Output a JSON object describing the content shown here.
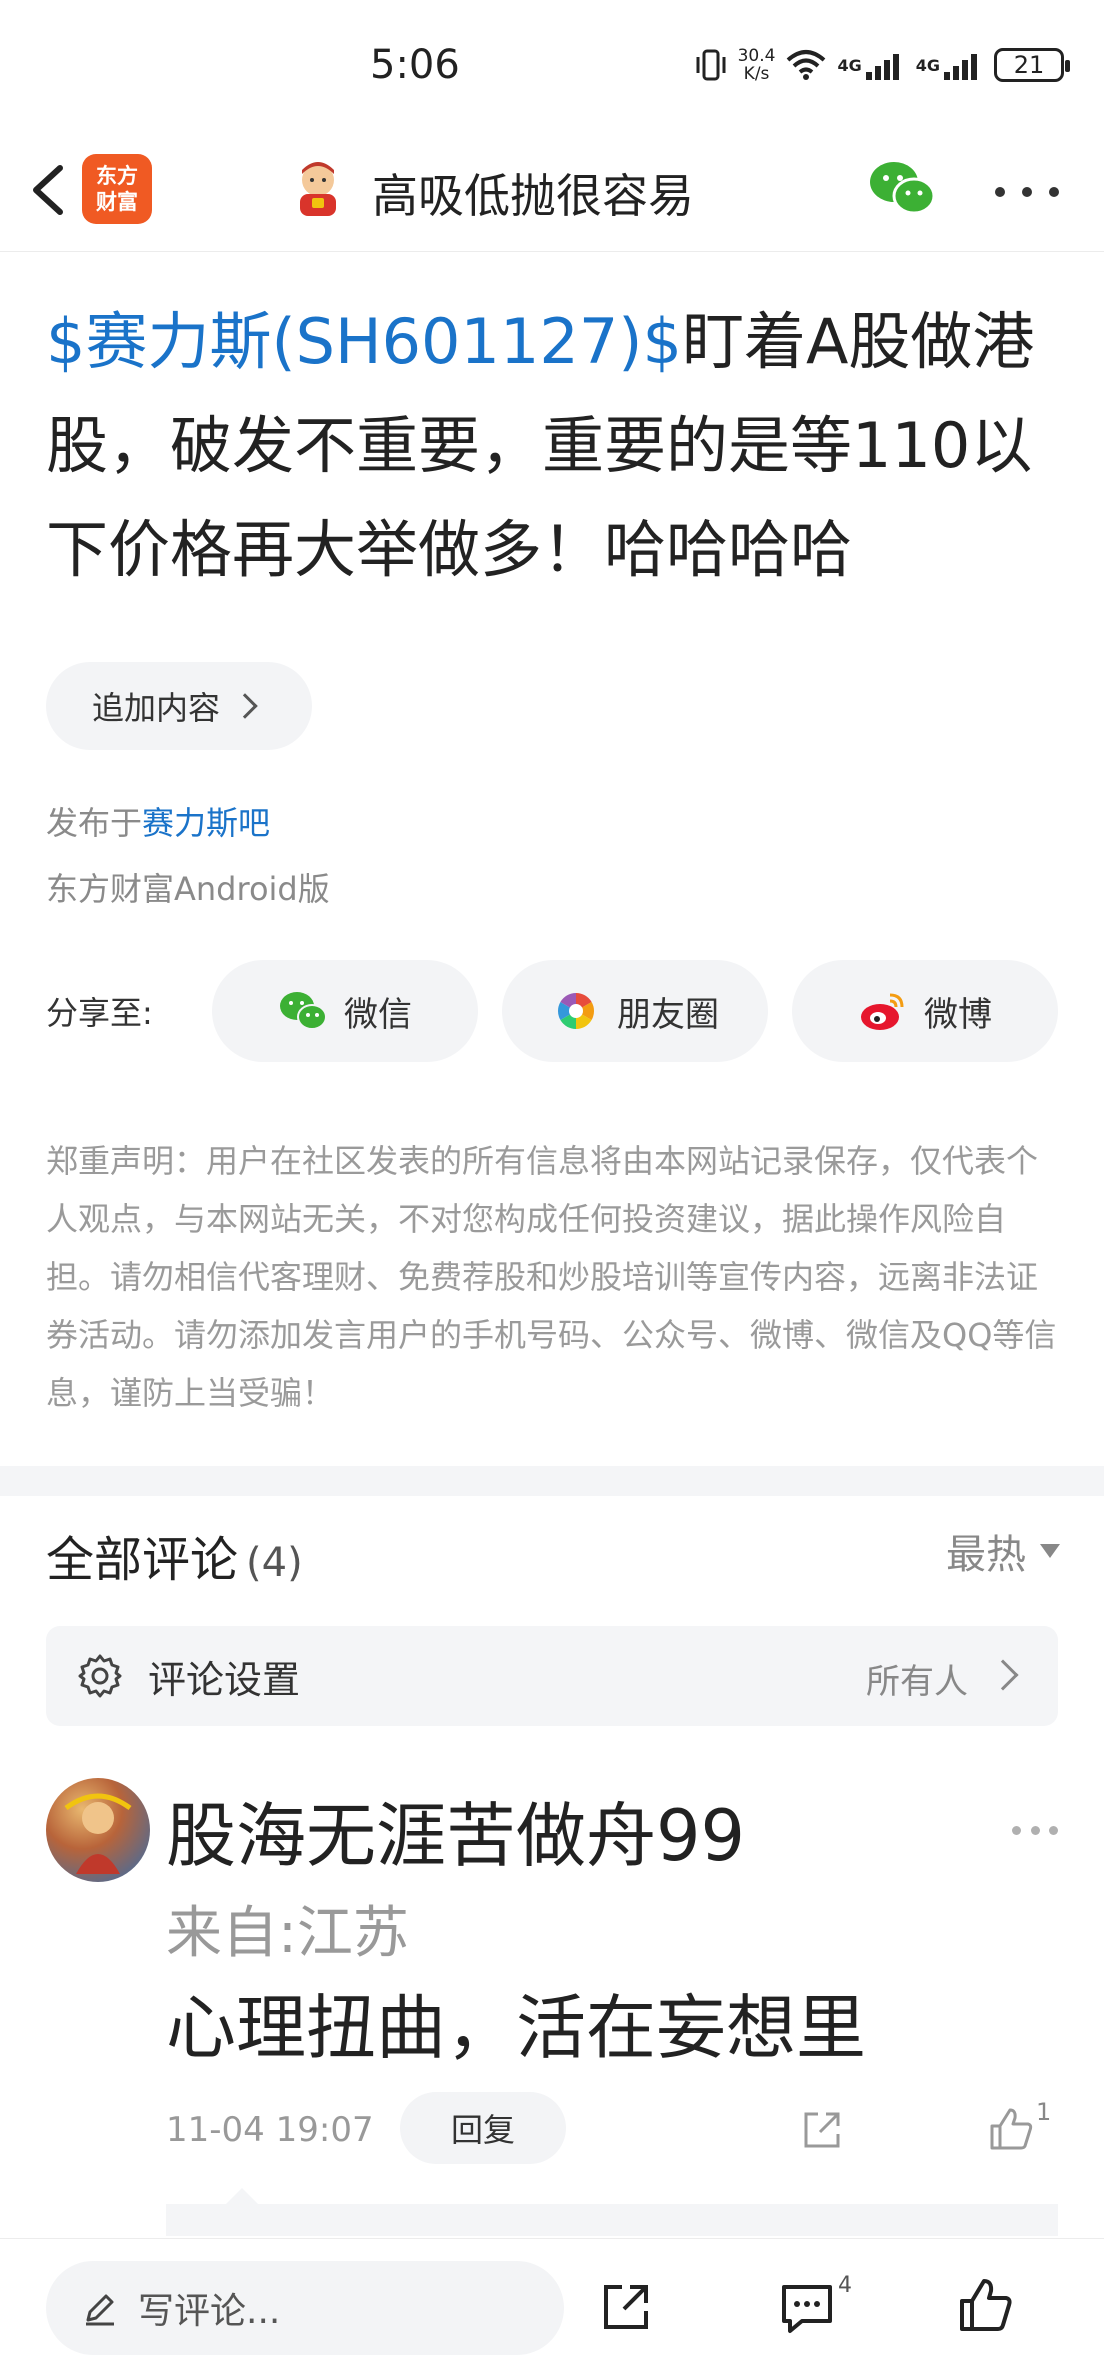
{
  "status_bar": {
    "time": "5:06",
    "net_speed_value": "30.4",
    "net_speed_unit": "K/s",
    "signal1_label": "4G",
    "signal2_label": "4G",
    "battery": "21"
  },
  "nav": {
    "app_logo_line1": "东方",
    "app_logo_line2": "财富",
    "title": "高吸低抛很容易",
    "icons": {
      "back": "back-icon",
      "wechat": "wechat-icon",
      "more": "more-icon"
    }
  },
  "post": {
    "stock_tag": "$赛力斯(SH601127)$",
    "body": "盯着A股做港股，破发不重要，重要的是等110以下价格再大举做多！哈哈哈哈",
    "append_label": "追加内容",
    "publish_prefix": "发布于",
    "publish_bar": "赛力斯吧",
    "client": "东方财富Android版"
  },
  "share": {
    "label": "分享至:",
    "wechat": "微信",
    "moments": "朋友圈",
    "weibo": "微博"
  },
  "disclaimer": "郑重声明：用户在社区发表的所有信息将由本网站记录保存，仅代表个人观点，与本网站无关，不对您构成任何投资建议，据此操作风险自担。请勿相信代客理财、免费荐股和炒股培训等宣传内容，远离非法证券活动。请勿添加发言用户的手机号码、公众号、微博、微信及QQ等信息，谨防上当受骗！",
  "comments": {
    "title": "全部评论",
    "count": "(4)",
    "sort": "最热",
    "settings_label": "评论设置",
    "settings_value": "所有人",
    "items": [
      {
        "user": "股海无涯苦做舟99",
        "location": "来自:江苏",
        "text": "心理扭曲，活在妄想里",
        "time": "11-04 19:07",
        "reply_label": "回复",
        "likes": "1"
      }
    ]
  },
  "bottom_bar": {
    "write_placeholder": "写评论...",
    "comment_count": "4"
  },
  "colors": {
    "accent_blue": "#1a73c9",
    "brand_orange": "#f05a23",
    "wechat_green": "#3cb034",
    "weibo_red": "#e6162d"
  }
}
